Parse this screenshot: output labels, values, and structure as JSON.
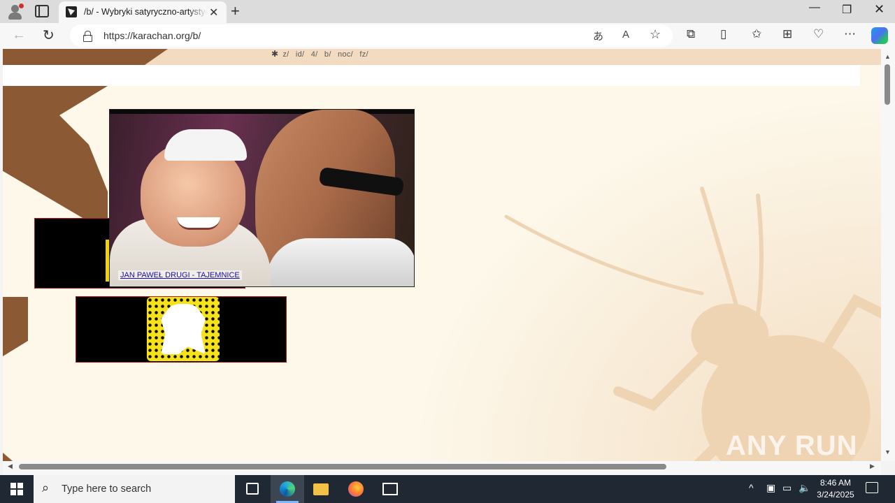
{
  "browser": {
    "tab_title": "/b/ - Wybryki satyryczno-artystyczne",
    "url": "https://karachan.org/b/",
    "new_tab": "+",
    "close_tab": "✕"
  },
  "board_nav": {
    "items": [
      "z/",
      "id/",
      "4/",
      "b/",
      "noc/",
      "fz/"
    ]
  },
  "banner": {
    "caption": "JAN PAWEŁ DRUGI - TAJEMNICE"
  },
  "watermark": "ANY RUN",
  "taskbar": {
    "search_placeholder": "Type here to search",
    "time": "8:46 AM",
    "date": "3/24/2025"
  },
  "colors": {
    "accent_brown": "#8b5a34",
    "background": "#fdf7e8",
    "link": "#1a0dab"
  },
  "icons": [
    "profile-icon",
    "tabs-icon",
    "back-icon",
    "reload-icon",
    "lock-icon",
    "translate-icon",
    "read-aloud-icon",
    "favorite-star-icon",
    "extensions-icon",
    "split-screen-icon",
    "favorites-icon",
    "collections-icon",
    "browser-essentials-icon",
    "more-icon",
    "copilot-icon",
    "windows-start-icon",
    "search-icon",
    "task-view-icon",
    "edge-icon",
    "file-explorer-icon",
    "firefox-icon",
    "terminal-icon"
  ]
}
